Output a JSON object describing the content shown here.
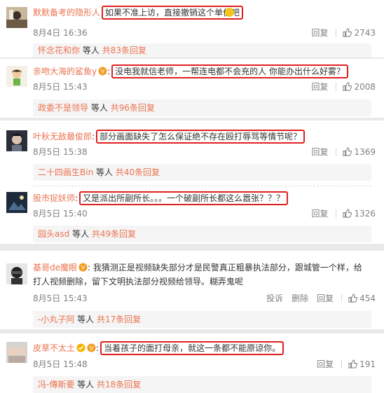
{
  "comments": [
    {
      "user": "默默备考的隐形人",
      "text": "如果不准上访，直接撤销这个单位吧",
      "time": "8月4日 16:36",
      "actions": [
        "回复"
      ],
      "likes": "2743",
      "reply_user": "怀念花和你",
      "reply_summary": "等人",
      "reply_link": "共83条回复"
    },
    {
      "user": "亲吻大海的鲨鱼y",
      "text": "没电我就信老师，一帮连电都不会充的人 你能办出什么好雾？",
      "time": "8月5日 15:43",
      "actions": [
        "回复"
      ],
      "likes": "2008",
      "reply_user": "政委不是领导",
      "reply_summary": "等人",
      "reply_link": "共96条回复"
    },
    {
      "user": "叶秋无敌最俊郎",
      "text": "部分画面缺失了怎么保证绝不存在殴打辱骂等情节呢？",
      "time": "8月5日 15:38",
      "actions": [
        "回复"
      ],
      "likes": "1369",
      "reply_user": "二十四画生Bin",
      "reply_summary": "等人",
      "reply_link": "共40条回复"
    },
    {
      "user": "股市捉妖师",
      "text": "又是派出所副所长。。。一个破副所长都这么嚣张？？？",
      "time": "8月5日 15:40",
      "actions": [
        "回复"
      ],
      "likes": "1326",
      "reply_user": "园头asd",
      "reply_summary": "等人",
      "reply_link": "共49条回复"
    },
    {
      "user": "基哥de魔眼",
      "text": "我猜测正是视频缺失部分才是民警真正粗暴执法部分，跟城管一个样，给打人视频删除，留下文明执法部分视频给领导。糊弄鬼呢",
      "time": "8月5日 15:43",
      "actions": [
        "投诉",
        "删除",
        "回复"
      ],
      "likes": "454",
      "reply_user": "-小丸子阿",
      "reply_summary": "等人",
      "reply_link": "共17条回复"
    },
    {
      "user": "皮草不太土",
      "text": "当着孩子的面打母亲，就这一条都不能原谅你。",
      "time": "8月5日 15:48",
      "actions": [
        "回复"
      ],
      "likes": "191",
      "reply_user": "冯-傳斯要",
      "reply_summary": "等人",
      "reply_link": "共18条回复"
    }
  ],
  "colors": {
    "username": "#eb7350",
    "highlight_border": "#e02020",
    "meta": "#808080"
  }
}
